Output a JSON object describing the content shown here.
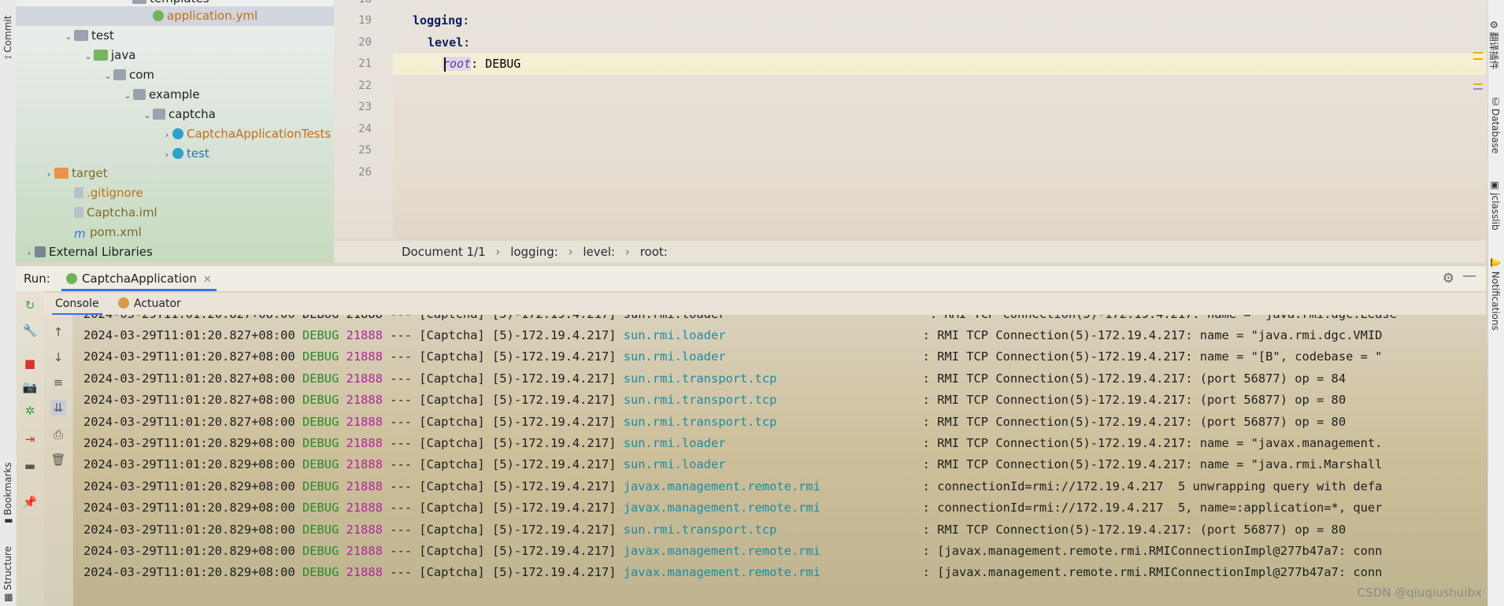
{
  "left_strip": {
    "commit": "Commit",
    "bookmarks": "Bookmarks",
    "structure": "Structure"
  },
  "right_strip": {
    "translate": "翻译插件",
    "database": "Database",
    "jclasslib": "jclasslib",
    "notifications": "Notifications"
  },
  "tree": {
    "partial_top": "templates",
    "items": [
      {
        "label": "application.yml",
        "depth": 6,
        "icon": "yml-icon",
        "style": "orange",
        "selected": true,
        "chevron": ""
      },
      {
        "label": "test",
        "depth": 2,
        "icon": "folder-icon",
        "style": "",
        "chevron": "⌄"
      },
      {
        "label": "java",
        "depth": 3,
        "icon": "folder-green-icon",
        "style": "",
        "chevron": "⌄"
      },
      {
        "label": "com",
        "depth": 4,
        "icon": "package-icon",
        "style": "",
        "chevron": "⌄"
      },
      {
        "label": "example",
        "depth": 5,
        "icon": "package-icon",
        "style": "",
        "chevron": "⌄"
      },
      {
        "label": "captcha",
        "depth": 6,
        "icon": "package-icon",
        "style": "",
        "chevron": "⌄"
      },
      {
        "label": "CaptchaApplicationTests",
        "depth": 7,
        "icon": "class-icon",
        "style": "orange",
        "chevron": "›"
      },
      {
        "label": "test",
        "depth": 7,
        "icon": "class-icon",
        "style": "blue",
        "chevron": "›"
      },
      {
        "label": "target",
        "depth": 1,
        "icon": "folder-orange-icon",
        "style": "olive",
        "chevron": "›"
      },
      {
        "label": ".gitignore",
        "depth": 2,
        "icon": "file-icon",
        "style": "orange",
        "chevron": ""
      },
      {
        "label": "Captcha.iml",
        "depth": 2,
        "icon": "file-icon",
        "style": "olive",
        "chevron": ""
      },
      {
        "label": "pom.xml",
        "depth": 2,
        "icon": "maven-icon",
        "style": "olive",
        "chevron": ""
      },
      {
        "label": "External Libraries",
        "depth": 0,
        "icon": "library-icon",
        "style": "",
        "chevron": "›"
      }
    ]
  },
  "editor": {
    "partial_top_line": "18",
    "lines": [
      {
        "num": "19",
        "key": "logging",
        "indent": 0,
        "value": ""
      },
      {
        "num": "20",
        "key": "level",
        "indent": 1,
        "value": ""
      },
      {
        "num": "21",
        "key": "root",
        "indent": 2,
        "value": " DEBUG"
      },
      {
        "num": "22",
        "key": "",
        "indent": 0,
        "value": ""
      },
      {
        "num": "23",
        "key": "",
        "indent": 0,
        "value": ""
      },
      {
        "num": "24",
        "key": "",
        "indent": 0,
        "value": ""
      },
      {
        "num": "25",
        "key": "",
        "indent": 0,
        "value": ""
      },
      {
        "num": "26",
        "key": "",
        "indent": 0,
        "value": ""
      }
    ]
  },
  "breadcrumb": [
    "Document 1/1",
    "logging:",
    "level:",
    "root:"
  ],
  "run": {
    "label": "Run:",
    "tab": "CaptchaApplication",
    "console_tab": "Console",
    "actuator_tab": "Actuator"
  },
  "console": {
    "partial_top": "2024-03-29T11:01:20.827+08:00 DEBUG 21888 --- [Captcha] [5)-172.19.4.217] sun.rmi.loader                            : RMI TCP Connection(5)-172.19.4.217: name = \"java.rmi.dgc.Lease",
    "lines": [
      {
        "ts": "2024-03-29T11:01:20.827+08:00",
        "level": "DEBUG",
        "pid": "21888",
        "thread": " --- [Captcha] [5)-172.19.4.217] ",
        "logger": "sun.rmi.loader                          ",
        "msg": " : RMI TCP Connection(5)-172.19.4.217: name = \"java.rmi.dgc.VMID"
      },
      {
        "ts": "2024-03-29T11:01:20.827+08:00",
        "level": "DEBUG",
        "pid": "21888",
        "thread": " --- [Captcha] [5)-172.19.4.217] ",
        "logger": "sun.rmi.loader                          ",
        "msg": " : RMI TCP Connection(5)-172.19.4.217: name = \"[B\", codebase = \""
      },
      {
        "ts": "2024-03-29T11:01:20.827+08:00",
        "level": "DEBUG",
        "pid": "21888",
        "thread": " --- [Captcha] [5)-172.19.4.217] ",
        "logger": "sun.rmi.transport.tcp                   ",
        "msg": " : RMI TCP Connection(5)-172.19.4.217: (port 56877) op = 84"
      },
      {
        "ts": "2024-03-29T11:01:20.827+08:00",
        "level": "DEBUG",
        "pid": "21888",
        "thread": " --- [Captcha] [5)-172.19.4.217] ",
        "logger": "sun.rmi.transport.tcp                   ",
        "msg": " : RMI TCP Connection(5)-172.19.4.217: (port 56877) op = 80"
      },
      {
        "ts": "2024-03-29T11:01:20.827+08:00",
        "level": "DEBUG",
        "pid": "21888",
        "thread": " --- [Captcha] [5)-172.19.4.217] ",
        "logger": "sun.rmi.transport.tcp                   ",
        "msg": " : RMI TCP Connection(5)-172.19.4.217: (port 56877) op = 80"
      },
      {
        "ts": "2024-03-29T11:01:20.829+08:00",
        "level": "DEBUG",
        "pid": "21888",
        "thread": " --- [Captcha] [5)-172.19.4.217] ",
        "logger": "sun.rmi.loader                          ",
        "msg": " : RMI TCP Connection(5)-172.19.4.217: name = \"javax.management."
      },
      {
        "ts": "2024-03-29T11:01:20.829+08:00",
        "level": "DEBUG",
        "pid": "21888",
        "thread": " --- [Captcha] [5)-172.19.4.217] ",
        "logger": "sun.rmi.loader                          ",
        "msg": " : RMI TCP Connection(5)-172.19.4.217: name = \"java.rmi.Marshall"
      },
      {
        "ts": "2024-03-29T11:01:20.829+08:00",
        "level": "DEBUG",
        "pid": "21888",
        "thread": " --- [Captcha] [5)-172.19.4.217] ",
        "logger": "javax.management.remote.rmi             ",
        "msg": " : connectionId=rmi://172.19.4.217  5 unwrapping query with defa"
      },
      {
        "ts": "2024-03-29T11:01:20.829+08:00",
        "level": "DEBUG",
        "pid": "21888",
        "thread": " --- [Captcha] [5)-172.19.4.217] ",
        "logger": "javax.management.remote.rmi             ",
        "msg": " : connectionId=rmi://172.19.4.217  5, name=:application=*, quer"
      },
      {
        "ts": "2024-03-29T11:01:20.829+08:00",
        "level": "DEBUG",
        "pid": "21888",
        "thread": " --- [Captcha] [5)-172.19.4.217] ",
        "logger": "sun.rmi.transport.tcp                   ",
        "msg": " : RMI TCP Connection(5)-172.19.4.217: (port 56877) op = 80"
      },
      {
        "ts": "2024-03-29T11:01:20.829+08:00",
        "level": "DEBUG",
        "pid": "21888",
        "thread": " --- [Captcha] [5)-172.19.4.217] ",
        "logger": "javax.management.remote.rmi             ",
        "msg": " : [javax.management.remote.rmi.RMIConnectionImpl@277b47a7: conn"
      },
      {
        "ts": "2024-03-29T11:01:20.829+08:00",
        "level": "DEBUG",
        "pid": "21888",
        "thread": " --- [Captcha] [5)-172.19.4.217] ",
        "logger": "javax.management.remote.rmi             ",
        "msg": " : [javax.management.remote.rmi.RMIConnectionImpl@277b47a7: conn"
      }
    ]
  },
  "watermark": "CSDN @qiuqiushuibx",
  "colors": {
    "accent": "#3574f0",
    "level": "#258a2b",
    "pid": "#b0249b",
    "logger": "#1c8aa3",
    "yaml_key": "#0a1f5c"
  }
}
